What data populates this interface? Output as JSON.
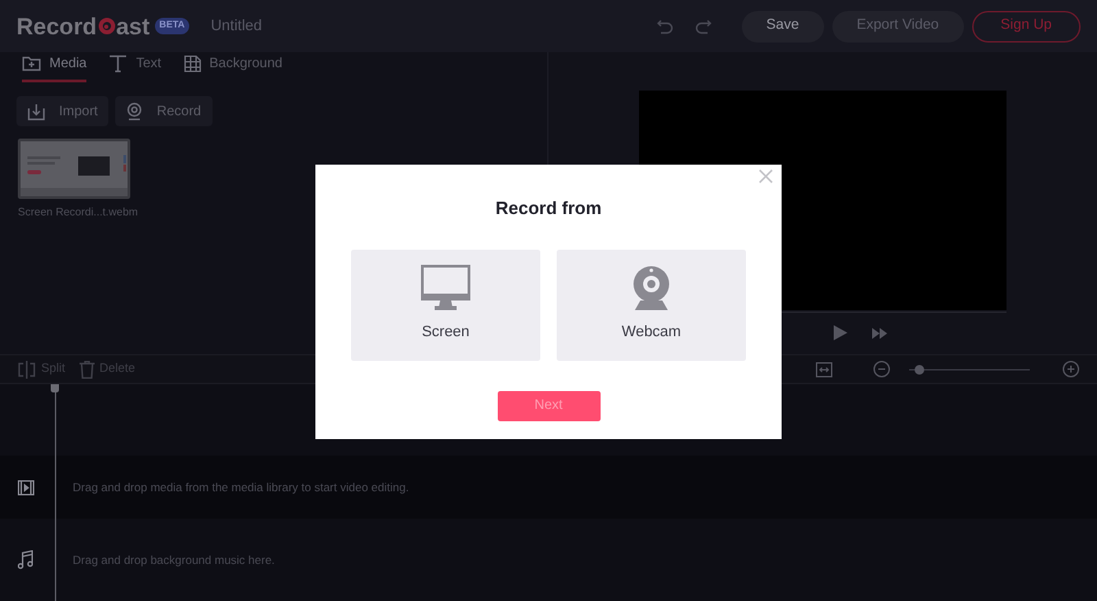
{
  "header": {
    "logo_start": "Record",
    "logo_end": "ast",
    "badge": "BETA",
    "project_title": "Untitled",
    "buttons": [
      {
        "label": "Save",
        "kind": "secondary",
        "disabled": false
      },
      {
        "label": "Export Video",
        "kind": "secondary",
        "disabled": true
      },
      {
        "label": "Sign Up",
        "kind": "outline",
        "disabled": false
      }
    ]
  },
  "tabs": [
    {
      "label": "Media",
      "kind": "folder",
      "selected": true
    },
    {
      "label": "Text",
      "kind": "text",
      "selected": false
    },
    {
      "label": "Background",
      "kind": "background",
      "selected": false
    }
  ],
  "media_actions": [
    {
      "label": "Import",
      "kind": "import"
    },
    {
      "label": "Record",
      "kind": "webcam"
    }
  ],
  "media_items": [
    {
      "name": "Screen Recordi...t.webm",
      "kind": "picture"
    }
  ],
  "toolbar": [
    {
      "label": "Split",
      "kind": "split"
    },
    {
      "label": "Delete",
      "kind": "trash"
    }
  ],
  "zoom": {
    "level": 0.08
  },
  "tracks": [
    {
      "kind": "video",
      "hint": "Drag and drop media from the media library to start video editing."
    },
    {
      "kind": "audio",
      "hint": "Drag and drop background music here."
    }
  ],
  "dialog": {
    "title": "Record from",
    "options": [
      {
        "label": "Screen",
        "kind": "monitor",
        "selected": false
      },
      {
        "label": "Webcam",
        "kind": "webcam",
        "selected": false
      }
    ],
    "next_button": {
      "label": "Next",
      "disabled": true
    }
  }
}
